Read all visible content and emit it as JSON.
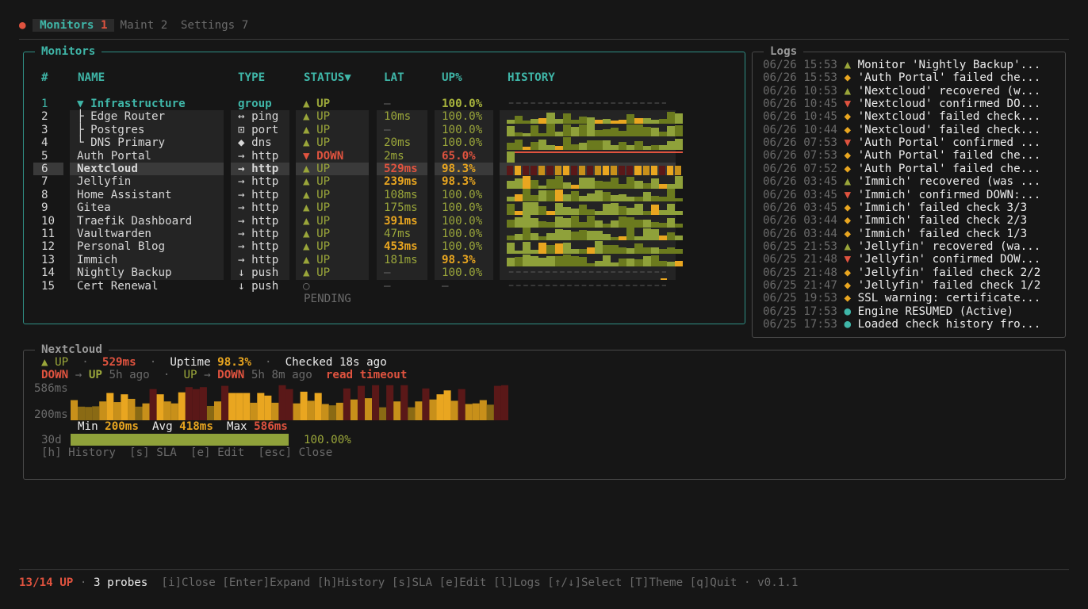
{
  "tabs": [
    {
      "label": "Monitors",
      "count": "1",
      "active": true
    },
    {
      "label": "Maint",
      "count": "2",
      "active": false
    },
    {
      "label": "Settings",
      "count": "7",
      "active": false
    }
  ],
  "monitors_panel": {
    "title": "Monitors",
    "headers": {
      "id": "#",
      "name": "NAME",
      "type": "TYPE",
      "status": "STATUS▼",
      "lat": "LAT",
      "up": "UP%",
      "history": "HISTORY"
    },
    "rows": [
      {
        "id": "1",
        "name": "▼ Infrastructure",
        "type": "group",
        "status": "▲ UP",
        "lat": "—",
        "up": "100.0%",
        "kind": "group",
        "history": "dots"
      },
      {
        "id": "2",
        "name": "├ Edge Router",
        "type": "↔ ping",
        "status": "▲ UP",
        "lat": "10ms",
        "up": "100.0%",
        "kind": "child",
        "history": "olive"
      },
      {
        "id": "3",
        "name": "├ Postgres",
        "type": "⊡ port",
        "status": "▲ UP",
        "lat": "—",
        "up": "100.0%",
        "kind": "child",
        "history": "olive"
      },
      {
        "id": "4",
        "name": "└ DNS Primary",
        "type": "◆ dns",
        "status": "▲ UP",
        "lat": "20ms",
        "up": "100.0%",
        "kind": "child",
        "history": "olive"
      },
      {
        "id": "5",
        "name": "Auth Portal",
        "type": "→ http",
        "status": "▼ DOWN",
        "lat": "2ms",
        "up": "65.0%",
        "kind": "down",
        "history": "down"
      },
      {
        "id": "6",
        "name": "Nextcloud",
        "type": "→ http",
        "status": "▲ UP",
        "lat": "529ms",
        "up": "98.3%",
        "kind": "selected",
        "history": "mixed"
      },
      {
        "id": "7",
        "name": "Jellyfin",
        "type": "→ http",
        "status": "▲ UP",
        "lat": "239ms",
        "up": "98.3%",
        "kind": "warn",
        "history": "olive"
      },
      {
        "id": "8",
        "name": "Home Assistant",
        "type": "→ http",
        "status": "▲ UP",
        "lat": "108ms",
        "up": "100.0%",
        "kind": "normal",
        "history": "olive"
      },
      {
        "id": "9",
        "name": "Gitea",
        "type": "→ http",
        "status": "▲ UP",
        "lat": "175ms",
        "up": "100.0%",
        "kind": "normal",
        "history": "olive"
      },
      {
        "id": "10",
        "name": "Traefik Dashboard",
        "type": "→ http",
        "status": "▲ UP",
        "lat": "391ms",
        "up": "100.0%",
        "kind": "latwarn",
        "history": "olive"
      },
      {
        "id": "11",
        "name": "Vaultwarden",
        "type": "→ http",
        "status": "▲ UP",
        "lat": "47ms",
        "up": "100.0%",
        "kind": "normal",
        "history": "olive"
      },
      {
        "id": "12",
        "name": "Personal Blog",
        "type": "→ http",
        "status": "▲ UP",
        "lat": "453ms",
        "up": "100.0%",
        "kind": "latwarn",
        "history": "olive"
      },
      {
        "id": "13",
        "name": "Immich",
        "type": "→ http",
        "status": "▲ UP",
        "lat": "181ms",
        "up": "98.3%",
        "kind": "upwarn",
        "history": "olive"
      },
      {
        "id": "14",
        "name": "Nightly Backup",
        "type": "↓ push",
        "status": "▲ UP",
        "lat": "—",
        "up": "100.0%",
        "kind": "normal",
        "history": "dots"
      },
      {
        "id": "15",
        "name": "Cert Renewal",
        "type": "↓ push",
        "status": "○",
        "status2": "PENDING",
        "lat": "—",
        "up": "—",
        "kind": "pending",
        "history": "dots"
      }
    ]
  },
  "logs_panel": {
    "title": "Logs",
    "entries": [
      {
        "ts": "06/26 15:53",
        "icon": "▲",
        "level": "up",
        "text": "Monitor 'Nightly Backup'..."
      },
      {
        "ts": "06/26 15:53",
        "icon": "◆",
        "level": "warn",
        "text": "'Auth Portal' failed che..."
      },
      {
        "ts": "06/26 10:53",
        "icon": "▲",
        "level": "up",
        "text": "'Nextcloud' recovered (w..."
      },
      {
        "ts": "06/26 10:45",
        "icon": "▼",
        "level": "down",
        "text": "'Nextcloud' confirmed DO..."
      },
      {
        "ts": "06/26 10:45",
        "icon": "◆",
        "level": "warn",
        "text": "'Nextcloud' failed check..."
      },
      {
        "ts": "06/26 10:44",
        "icon": "◆",
        "level": "warn",
        "text": "'Nextcloud' failed check..."
      },
      {
        "ts": "06/26 07:53",
        "icon": "▼",
        "level": "down",
        "text": "'Auth Portal' confirmed ..."
      },
      {
        "ts": "06/26 07:53",
        "icon": "◆",
        "level": "warn",
        "text": "'Auth Portal' failed che..."
      },
      {
        "ts": "06/26 07:52",
        "icon": "◆",
        "level": "warn",
        "text": "'Auth Portal' failed che..."
      },
      {
        "ts": "06/26 03:45",
        "icon": "▲",
        "level": "up",
        "text": "'Immich' recovered (was ..."
      },
      {
        "ts": "06/26 03:45",
        "icon": "▼",
        "level": "down",
        "text": "'Immich' confirmed DOWN:..."
      },
      {
        "ts": "06/26 03:45",
        "icon": "◆",
        "level": "warn",
        "text": "'Immich' failed check 3/3"
      },
      {
        "ts": "06/26 03:44",
        "icon": "◆",
        "level": "warn",
        "text": "'Immich' failed check 2/3"
      },
      {
        "ts": "06/26 03:44",
        "icon": "◆",
        "level": "warn",
        "text": "'Immich' failed check 1/3"
      },
      {
        "ts": "06/25 21:53",
        "icon": "▲",
        "level": "up",
        "text": "'Jellyfin' recovered (wa..."
      },
      {
        "ts": "06/25 21:48",
        "icon": "▼",
        "level": "down",
        "text": "'Jellyfin' confirmed DOW..."
      },
      {
        "ts": "06/25 21:48",
        "icon": "◆",
        "level": "warn",
        "text": "'Jellyfin' failed check 2/2"
      },
      {
        "ts": "06/25 21:47",
        "icon": "◆",
        "level": "warn",
        "text": "'Jellyfin' failed check 1/2"
      },
      {
        "ts": "06/25 19:53",
        "icon": "◆",
        "level": "warn",
        "text": "SSL warning: certificate..."
      },
      {
        "ts": "06/25 17:53",
        "icon": "●",
        "level": "info",
        "text": "Engine RESUMED (Active)"
      },
      {
        "ts": "06/25 17:53",
        "icon": "●",
        "level": "info",
        "text": "Loaded check history fro..."
      }
    ]
  },
  "detail_panel": {
    "title": "Nextcloud",
    "status": "▲ UP",
    "latency": "529ms",
    "uptime_label": "Uptime",
    "uptime": "98.3%",
    "checked": "Checked 18s ago",
    "sep": "·",
    "transition1": {
      "from": "DOWN",
      "arrow": "→",
      "to": "UP",
      "ago": "5h ago"
    },
    "transition2": {
      "from": "UP",
      "arrow": "→",
      "to": "DOWN",
      "ago": "5h 8m ago",
      "reason": "read timeout"
    },
    "y_max_label": "586ms",
    "y_mid_label": "200ms",
    "min_label": "Min",
    "min": "200ms",
    "avg_label": "Avg",
    "avg": "418ms",
    "max_label": "Max",
    "max": "586ms",
    "period": "30d",
    "period_uptime": "100.00%",
    "period_uptime_fraction": 1.0,
    "hints": "[h] History  [s] SLA  [e] Edit  [esc] Close",
    "latency_series_ms": [
      310,
      210,
      205,
      215,
      290,
      420,
      280,
      400,
      330,
      210,
      260,
      480,
      400,
      290,
      260,
      430,
      510,
      480,
      510,
      220,
      290,
      530,
      420,
      420,
      420,
      270,
      420,
      380,
      270,
      540,
      480,
      260,
      440,
      300,
      420,
      250,
      230,
      270,
      490,
      320,
      530,
      340,
      540,
      200,
      540,
      290,
      540,
      200,
      290,
      490,
      320,
      400,
      460,
      300,
      480,
      250,
      260,
      310,
      240,
      530,
      540
    ]
  },
  "footer": {
    "up_count": "13/14 UP",
    "sep": "·",
    "probes": "3 probes",
    "keys": "[i]Close [Enter]Expand [h]History [s]SLA [e]Edit [l]Logs [↑/↓]Select [T]Theme [q]Quit",
    "version": "v0.1.1"
  },
  "colors": {
    "accent": "#3fb6a8",
    "up": "#9aa63a",
    "down": "#e0533f",
    "warn": "#e9a620",
    "dim": "#6a6a6a",
    "background": "#161616"
  }
}
